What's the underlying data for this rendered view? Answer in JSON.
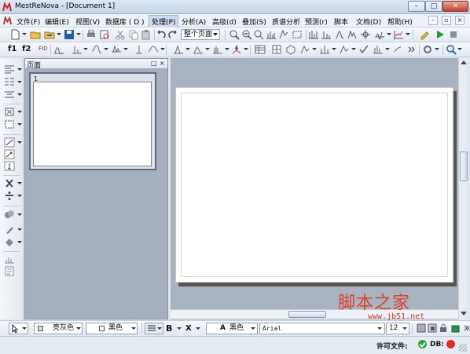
{
  "window": {
    "title": "MestReNova - [Document 1]",
    "controls": {
      "minimize": "–",
      "maximize": "□",
      "close": "✕"
    }
  },
  "menubar": {
    "items": [
      "文件(F)",
      "编辑(E)",
      "视图(V)",
      "数据库 ( D )",
      "处理(P)",
      "分析(A)",
      "高级(d)",
      "叠加(S)",
      "质谱分析",
      "预测(r)",
      "脚本",
      "文档(D)",
      "帮助(H)"
    ],
    "active_item": "处理(P)"
  },
  "toolbar": {
    "page_mode_combo": "整个页面",
    "label_f1": "f1",
    "label_f2": "f2",
    "label_fid": "FID"
  },
  "pages_panel": {
    "title": "页面",
    "float_control": "□",
    "close_control": "×",
    "thumbnail_number": "1"
  },
  "format_bar": {
    "fill_color": "亮灰色",
    "line_color": "黑色",
    "bold_label": "B",
    "subscript_label": "X",
    "text_color_prefix": "A",
    "text_color": "黑色",
    "font_name": "Arial",
    "font_size": "12"
  },
  "status_bar": {
    "license_label": "许可文件:",
    "db_label": "DB:"
  },
  "watermark": {
    "text": "脚本之家",
    "url": "www.jb51.net"
  },
  "colors": {
    "accent": "#2b5fa5",
    "license_ok": "#2fa33b",
    "db_status": "#d7312a",
    "watermark": "#e0402e"
  }
}
